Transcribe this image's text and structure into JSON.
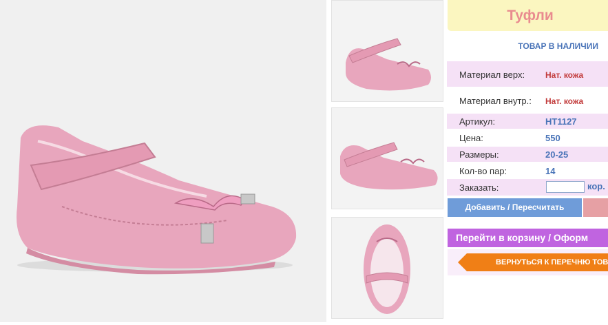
{
  "product": {
    "title": "Туфли",
    "stock_status": "ТОВАР В НАЛИЧИИ",
    "specs": [
      {
        "label": "Материал верх:",
        "value": "Нат. кожа"
      },
      {
        "label": "Материал внутр.:",
        "value": "Нат. кожа"
      },
      {
        "label": "Артикул:",
        "value": "НТ1127"
      },
      {
        "label": "Цена:",
        "value": "550"
      },
      {
        "label": "Размеры:",
        "value": "20-25"
      },
      {
        "label": "Кол-во пар:",
        "value": "14"
      }
    ],
    "order": {
      "label": "Заказать:",
      "quantity": "",
      "cart_link": "кор."
    }
  },
  "actions": {
    "add_label": "Добавить / Пересчитать",
    "checkout_label": "Перейти в корзину / Оформ",
    "back_label": "ВЕРНУТЬСЯ К ПЕРЕЧНЮ ТОВ"
  },
  "colors": {
    "title_bg": "#fbf6c0",
    "title_text": "#e98b8f",
    "spec_row_bg": "#f5e1f6",
    "add_button": "#6f9cd9",
    "checkout_button": "#c064e0",
    "back_button": "#f07f16",
    "shoe": "#e8a6bd"
  },
  "images": {
    "main": "pink-shoe-side-view",
    "thumbnails": [
      "pink-shoe-three-quarter",
      "pink-shoe-side",
      "pink-shoe-top-view"
    ]
  }
}
